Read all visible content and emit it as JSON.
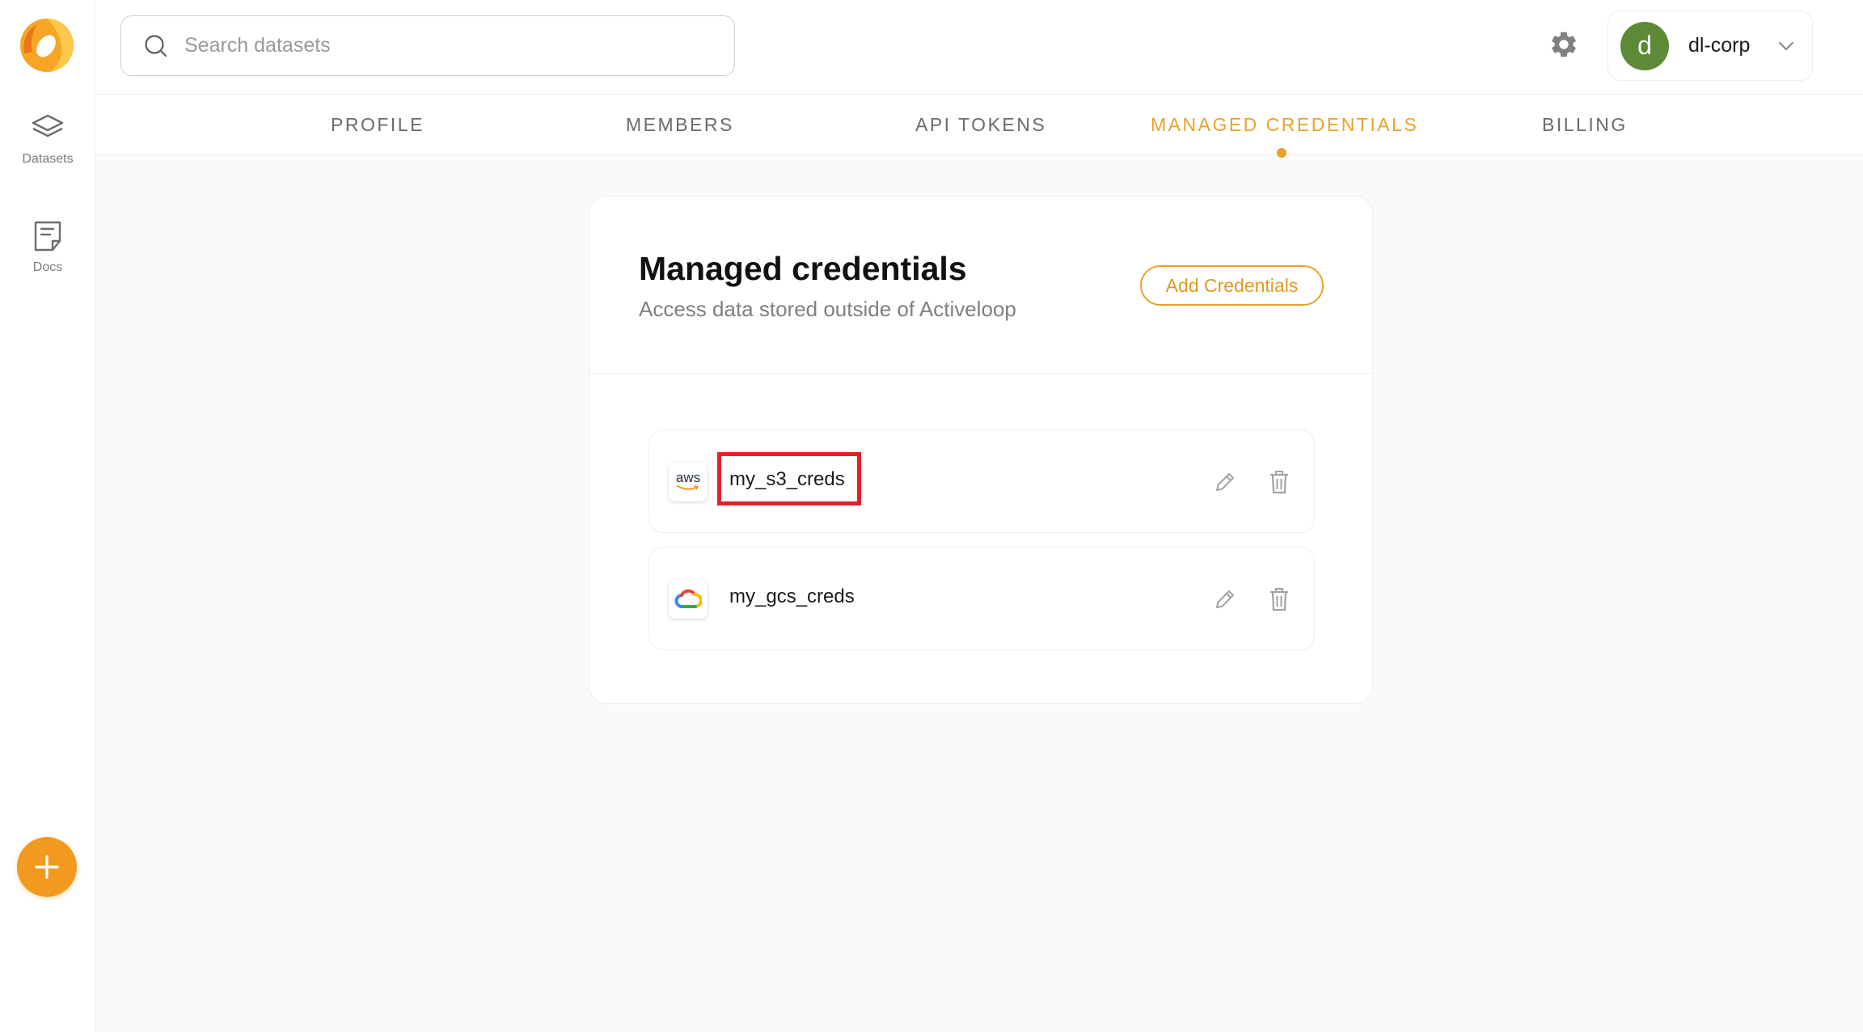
{
  "sidebar": {
    "logo_icon": "activeloop-logo-icon",
    "items": [
      {
        "label": "Datasets",
        "icon": "layers-icon"
      },
      {
        "label": "Docs",
        "icon": "document-icon"
      }
    ],
    "fab_icon": "plus-icon"
  },
  "header": {
    "search": {
      "placeholder": "Search datasets",
      "value": ""
    },
    "settings_icon": "gear-icon",
    "org": {
      "avatar_letter": "d",
      "name": "dl-corp",
      "avatar_color": "#5e8a37"
    }
  },
  "tabs": [
    {
      "label": "PROFILE",
      "active": false
    },
    {
      "label": "MEMBERS",
      "active": false
    },
    {
      "label": "API TOKENS",
      "active": false
    },
    {
      "label": "MANAGED CREDENTIALS",
      "active": true
    },
    {
      "label": "BILLING",
      "active": false
    }
  ],
  "main": {
    "title": "Managed credentials",
    "subtitle": "Access data stored outside of Activeloop",
    "add_button": "Add Credentials",
    "credentials": [
      {
        "name": "my_s3_creds",
        "provider": "aws",
        "provider_label": "aws",
        "highlighted": true
      },
      {
        "name": "my_gcs_creds",
        "provider": "google-cloud",
        "highlighted": false
      }
    ]
  },
  "colors": {
    "accent": "#e9a227",
    "fab": "#f29a1f",
    "highlight": "#e3202a"
  }
}
